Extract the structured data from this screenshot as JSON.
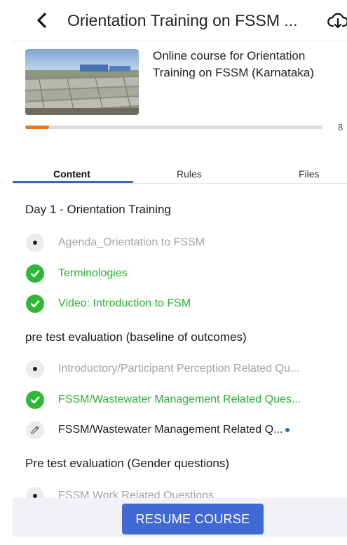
{
  "header": {
    "title": "Orientation Training on FSSM ...",
    "back_icon": "chevron-left-icon",
    "download_icon": "cloud-download-icon"
  },
  "course": {
    "description": "Online course for Orientation Training on FSSM (Karnataka)",
    "progress_fraction": 0.08,
    "progress_text": "8"
  },
  "tabs": [
    {
      "label": "Content",
      "active": true
    },
    {
      "label": "Rules",
      "active": false
    },
    {
      "label": "Files",
      "active": false
    }
  ],
  "sections": [
    {
      "title": "Day 1 - Orientation Training",
      "items": [
        {
          "label": "Agenda_Orientation to FSSM",
          "status": "viewed",
          "icon": "dot-circle-icon"
        },
        {
          "label": "Terminologies",
          "status": "completed",
          "icon": "check-circle-icon"
        },
        {
          "label": "Video: Introduction to FSM",
          "status": "completed",
          "icon": "check-circle-icon"
        }
      ]
    },
    {
      "title": "pre test evaluation (baseline of outcomes)",
      "items": [
        {
          "label": "Introductory/Participant Perception Related Qu...",
          "status": "viewed",
          "icon": "dot-circle-icon"
        },
        {
          "label": "FSSM/Wastewater Management Related Ques...",
          "status": "completed",
          "icon": "check-circle-icon"
        },
        {
          "label": "FSSM/Wastewater Management Related Q...",
          "status": "inprogress",
          "icon": "pencil-icon"
        }
      ]
    },
    {
      "title": "Pre test evaluation (Gender questions)",
      "items": [
        {
          "label": "FSSM Work Related Questions",
          "status": "viewed",
          "icon": "dot-circle-icon"
        }
      ]
    }
  ],
  "footer": {
    "resume_label": "RESUME COURSE"
  },
  "colors": {
    "accent": "#4169d6",
    "progress": "#f2711c",
    "completed": "#2eb838",
    "viewed_text": "#a4a4a4"
  }
}
